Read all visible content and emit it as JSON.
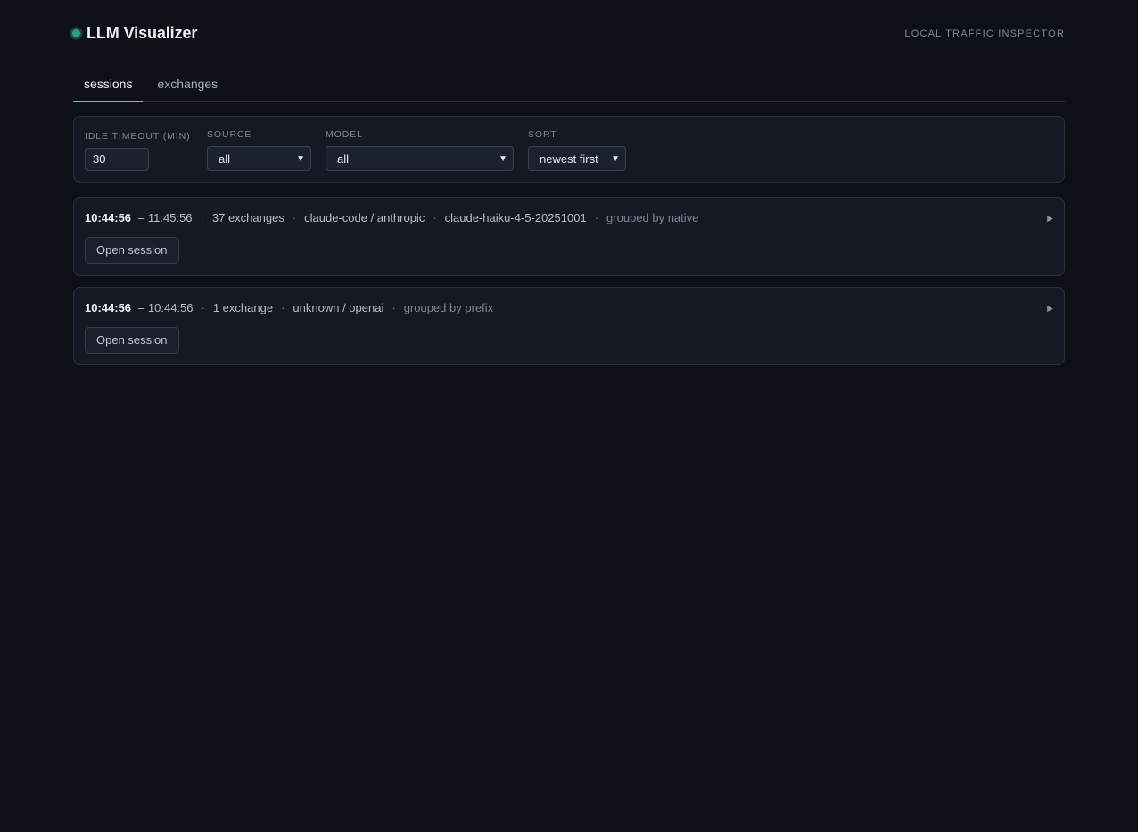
{
  "header": {
    "title": "LLM Visualizer",
    "subtitle": "LOCAL TRAFFIC INSPECTOR"
  },
  "tabs": [
    {
      "label": "sessions",
      "active": true
    },
    {
      "label": "exchanges",
      "active": false
    }
  ],
  "filters": {
    "idle_timeout": {
      "label": "IDLE TIMEOUT (MIN)",
      "value": "30"
    },
    "source": {
      "label": "SOURCE",
      "value": "all"
    },
    "model": {
      "label": "MODEL",
      "value": "all"
    },
    "sort": {
      "label": "SORT",
      "value": "newest first"
    }
  },
  "sessions": [
    {
      "start": "10:44:56",
      "end": "– 11:45:56",
      "exchanges": "37 exchanges",
      "source": "claude-code / anthropic",
      "model": "claude-haiku-4-5-20251001",
      "grouping": "grouped by native",
      "button": "Open session"
    },
    {
      "start": "10:44:56",
      "end": "– 10:44:56",
      "exchanges": "1 exchange",
      "source": "unknown / openai",
      "grouping": "grouped by prefix",
      "button": "Open session"
    }
  ],
  "icons": {
    "status": "status-dot-icon",
    "expand": "expand-triangle-icon",
    "dropdown": "chevron-down-icon"
  },
  "colors": {
    "background": "#0d1017",
    "card": "#151923",
    "accent": "#56c8b3",
    "status_dot": "#2f9c86"
  }
}
